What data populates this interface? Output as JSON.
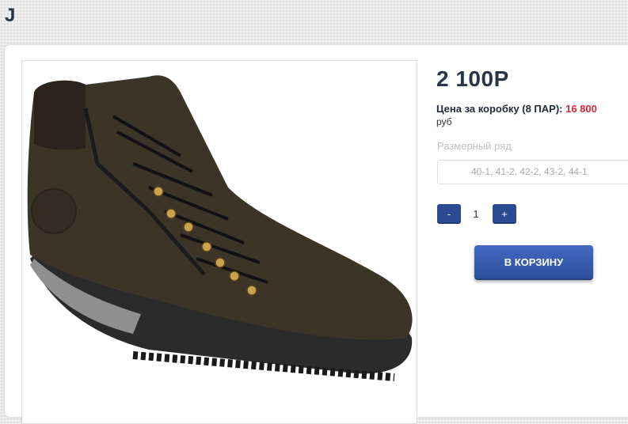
{
  "header": {
    "letter": "J"
  },
  "product": {
    "image_icon": "boot-photo",
    "price": "2 100Р",
    "box_price_label": "Цена за коробку (8 ПАР):",
    "box_price_value": "16 800",
    "box_price_currency": "руб",
    "size_label": "Размерный ряд",
    "size_value": "40-1, 41-2, 42-2, 43-2, 44-1",
    "quantity": {
      "minus_label": "-",
      "value": "1",
      "plus_label": "+"
    },
    "cart_button_label": "В КОРЗИНУ"
  },
  "colors": {
    "accent": "#2b4b92",
    "price_highlight": "#d62736",
    "text_dark": "#2a3447"
  }
}
